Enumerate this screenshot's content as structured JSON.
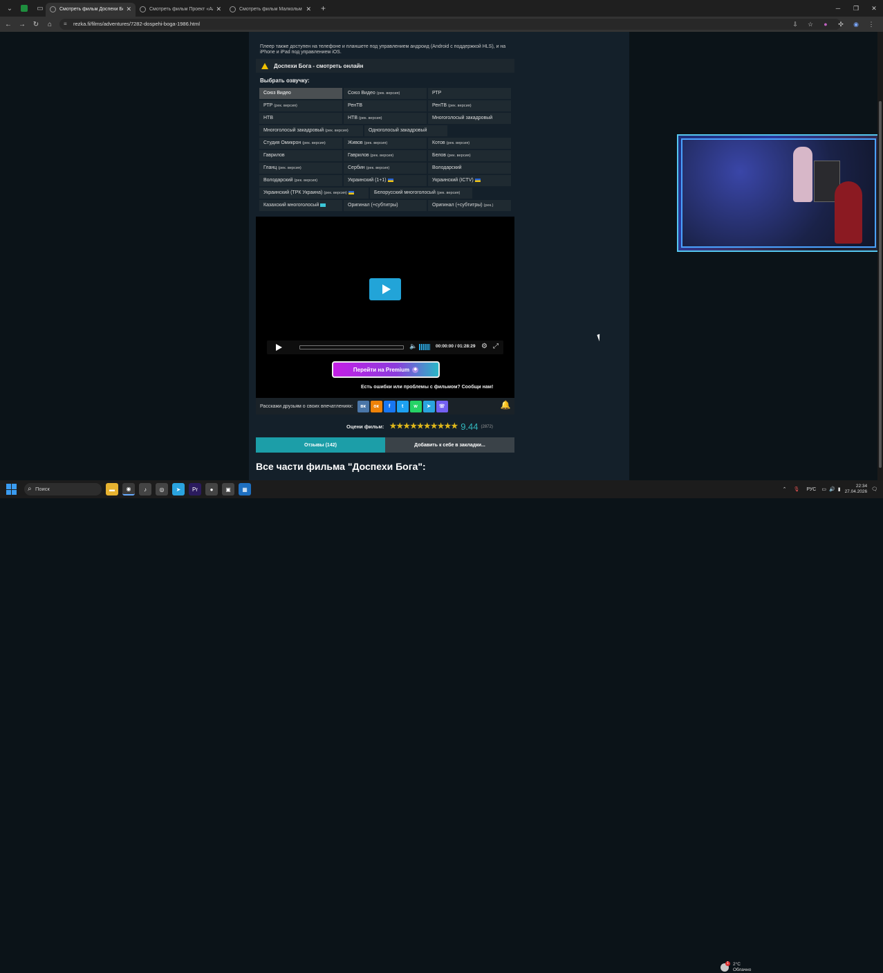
{
  "browser": {
    "tabs": [
      {
        "label": "Смотреть фильм Доспехи Бога",
        "active": true
      },
      {
        "label": "Смотреть фильм Проект «Аа",
        "active": false
      },
      {
        "label": "Смотреть фильм Малкольм и",
        "active": false
      }
    ],
    "url": "rezka.fi/films/adventures/7282-dospehi-boga-1986.html"
  },
  "content": {
    "note": "Плеер также доступен на телефоне и планшете под управлением андроид (Android с поддержкой HLS), и на iPhone и iPad под управлением iOS.",
    "warning_title": "Доспехи Бога - смотреть онлайн",
    "voice_label": "Выбрать озвучку:",
    "voice_rows": [
      [
        {
          "t": "Союз Видео",
          "s": "",
          "sel": true
        },
        {
          "t": "Союз Видео",
          "s": "(рек. версия)"
        },
        {
          "t": "РТР",
          "s": ""
        }
      ],
      [
        {
          "t": "РТР",
          "s": "(рек. версия)"
        },
        {
          "t": "РенТВ",
          "s": ""
        },
        {
          "t": "РенТВ",
          "s": "(рек. версия)"
        }
      ],
      [
        {
          "t": "НТВ",
          "s": ""
        },
        {
          "t": "НТВ",
          "s": "(рек. версия)"
        },
        {
          "t": "Многоголосый закадровый",
          "s": ""
        }
      ],
      [
        {
          "t": "Многоголосый закадровый",
          "s": "(рек. версия)"
        },
        {
          "t": "Одноголосый закадровый",
          "s": ""
        }
      ],
      [
        {
          "t": "Студия Омикрон",
          "s": "(рек. версия)"
        },
        {
          "t": "Живов",
          "s": "(рек. версия)"
        },
        {
          "t": "Котов",
          "s": "(рек. версия)"
        }
      ],
      [
        {
          "t": "Гаврилов",
          "s": ""
        },
        {
          "t": "Гаврилов",
          "s": "(рек. версия)"
        },
        {
          "t": "Белов",
          "s": "(рек. версия)"
        }
      ],
      [
        {
          "t": "Гланц",
          "s": "(рек. версия)"
        },
        {
          "t": "Сербин",
          "s": "(рек. версия)"
        },
        {
          "t": "Володарский",
          "s": ""
        }
      ],
      [
        {
          "t": "Володарский",
          "s": "(рек. версия)"
        },
        {
          "t": "Украинский (1+1)",
          "s": "",
          "flag": "ua"
        },
        {
          "t": "Украинский (ICTV)",
          "s": "",
          "flag": "ua"
        }
      ],
      [
        {
          "t": "Украинский (ТРК Украина)",
          "s": "(рек. версия)",
          "flag": "ua"
        },
        {
          "t": "Белорусский многоголосый",
          "s": "(рек. версия)"
        }
      ],
      [
        {
          "t": "Казахский многоголосый",
          "s": "",
          "flag": "kz"
        },
        {
          "t": "Оригинал (+субтитры)",
          "s": ""
        },
        {
          "t": "Оригинал (+субтитры)",
          "s": "(рек.)"
        }
      ]
    ],
    "player": {
      "time": "00:00:00 / 01:28:29",
      "progress": 0,
      "premium_label": "Перейти на Premium",
      "error_text": "Есть ошибки или проблемы с фильмом? Сообщи нам!"
    },
    "share_label": "Расскажи друзьям о своих впечатлениях:",
    "socials": [
      "vk",
      "ok",
      "facebook",
      "twitter",
      "whatsapp",
      "telegram",
      "viber"
    ],
    "rating": {
      "label": "Оцени фильм:",
      "stars": 10,
      "score": "9.44",
      "votes": "(2872)"
    },
    "tab_reviews": "Отзывы (142)",
    "tab_bookmarks": "Добавить к себе в закладки...",
    "all_parts": "Все части фильма \"Доспехи Бога\":"
  },
  "taskbar": {
    "search": "Поиск",
    "weather_temp": "2°C",
    "weather_desc": "Облачно",
    "weather_badge": "1",
    "lang": "РУС",
    "time": "22:34",
    "date": "27.04.2026"
  },
  "colors": {
    "accent": "#1c9ea8",
    "play": "#22a4d8",
    "star": "#e0b81a"
  }
}
